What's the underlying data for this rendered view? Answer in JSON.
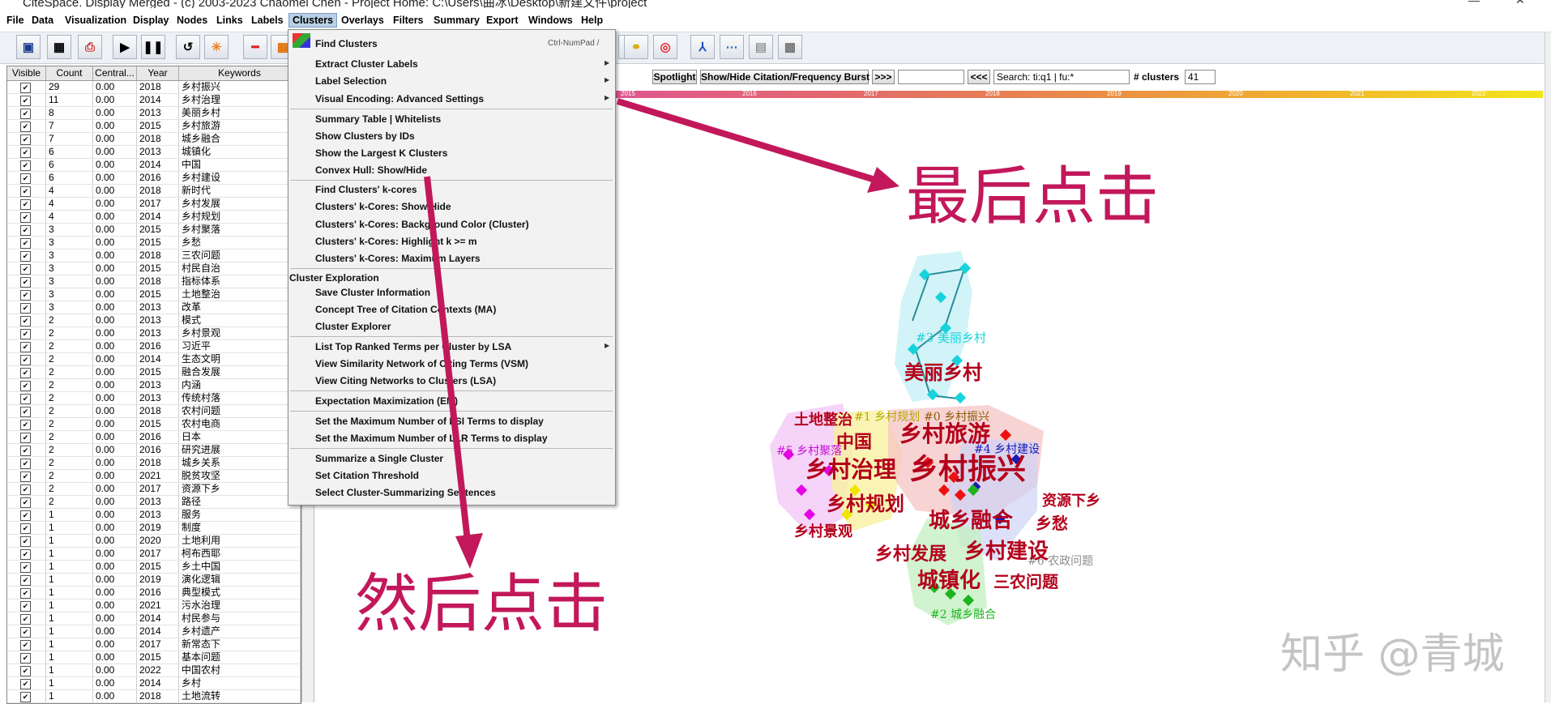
{
  "window": {
    "title": "CiteSpace. Display Merged - (c) 2003-2023 Chaomei Chen - Project Home: C:\\Users\\曲冰\\Desktop\\新建文件\\project"
  },
  "menubar": [
    "File",
    "Data",
    "Visualization",
    "Display",
    "Nodes",
    "Links",
    "Labels",
    "Clusters",
    "Overlays",
    "Filters",
    "Summary",
    "Export",
    "Windows",
    "Help"
  ],
  "menubar_active": "Clusters",
  "table": {
    "headers": [
      "Visible",
      "Count",
      "Central...",
      "Year",
      "Keywords"
    ],
    "rows": [
      [
        "29",
        "0.00",
        "2018",
        "乡村振兴"
      ],
      [
        "11",
        "0.00",
        "2014",
        "乡村治理"
      ],
      [
        "8",
        "0.00",
        "2013",
        "美丽乡村"
      ],
      [
        "7",
        "0.00",
        "2015",
        "乡村旅游"
      ],
      [
        "7",
        "0.00",
        "2018",
        "城乡融合"
      ],
      [
        "6",
        "0.00",
        "2013",
        "城镇化"
      ],
      [
        "6",
        "0.00",
        "2014",
        "中国"
      ],
      [
        "6",
        "0.00",
        "2016",
        "乡村建设"
      ],
      [
        "4",
        "0.00",
        "2018",
        "新时代"
      ],
      [
        "4",
        "0.00",
        "2017",
        "乡村发展"
      ],
      [
        "4",
        "0.00",
        "2014",
        "乡村规划"
      ],
      [
        "3",
        "0.00",
        "2015",
        "乡村聚落"
      ],
      [
        "3",
        "0.00",
        "2015",
        "乡愁"
      ],
      [
        "3",
        "0.00",
        "2018",
        "三农问题"
      ],
      [
        "3",
        "0.00",
        "2015",
        "村民自治"
      ],
      [
        "3",
        "0.00",
        "2018",
        "指标体系"
      ],
      [
        "3",
        "0.00",
        "2015",
        "土地整治"
      ],
      [
        "3",
        "0.00",
        "2013",
        "改革"
      ],
      [
        "2",
        "0.00",
        "2013",
        "模式"
      ],
      [
        "2",
        "0.00",
        "2013",
        "乡村景观"
      ],
      [
        "2",
        "0.00",
        "2016",
        "习近平"
      ],
      [
        "2",
        "0.00",
        "2014",
        "生态文明"
      ],
      [
        "2",
        "0.00",
        "2015",
        "融合发展"
      ],
      [
        "2",
        "0.00",
        "2013",
        "内涵"
      ],
      [
        "2",
        "0.00",
        "2013",
        "传统村落"
      ],
      [
        "2",
        "0.00",
        "2018",
        "农村问题"
      ],
      [
        "2",
        "0.00",
        "2015",
        "农村电商"
      ],
      [
        "2",
        "0.00",
        "2016",
        "日本"
      ],
      [
        "2",
        "0.00",
        "2016",
        "研究进展"
      ],
      [
        "2",
        "0.00",
        "2018",
        "城乡关系"
      ],
      [
        "2",
        "0.00",
        "2021",
        "脱贫攻坚"
      ],
      [
        "2",
        "0.00",
        "2017",
        "资源下乡"
      ],
      [
        "2",
        "0.00",
        "2013",
        "路径"
      ],
      [
        "1",
        "0.00",
        "2013",
        "服务"
      ],
      [
        "1",
        "0.00",
        "2019",
        "制度"
      ],
      [
        "1",
        "0.00",
        "2020",
        "土地利用"
      ],
      [
        "1",
        "0.00",
        "2017",
        "柯布西耶"
      ],
      [
        "1",
        "0.00",
        "2015",
        "乡土中国"
      ],
      [
        "1",
        "0.00",
        "2019",
        "演化逻辑"
      ],
      [
        "1",
        "0.00",
        "2016",
        "典型模式"
      ],
      [
        "1",
        "0.00",
        "2021",
        "污水治理"
      ],
      [
        "1",
        "0.00",
        "2014",
        "村民参与"
      ],
      [
        "1",
        "0.00",
        "2014",
        "乡村遗产"
      ],
      [
        "1",
        "0.00",
        "2017",
        "新常态下"
      ],
      [
        "1",
        "0.00",
        "2015",
        "基本问题"
      ],
      [
        "1",
        "0.00",
        "2022",
        "中国农村"
      ],
      [
        "1",
        "0.00",
        "2014",
        "乡村"
      ],
      [
        "1",
        "0.00",
        "2018",
        "土地流转"
      ]
    ]
  },
  "clusters_menu": {
    "find_clusters": "Find Clusters",
    "find_shortcut": "Ctrl-NumPad /",
    "items_group1": [
      "Extract Cluster Labels",
      "Label Selection",
      "Visual Encoding: Advanced Settings"
    ],
    "items_group2": [
      "Summary Table | Whitelists",
      "Show Clusters by IDs",
      "Show the Largest K Clusters",
      "Convex Hull: Show/Hide"
    ],
    "items_group3": [
      "Find Clusters' k-cores",
      "Clusters' k-Cores: Show/Hide",
      "Clusters' k-Cores: Background Color (Cluster)",
      "Clusters' k-Cores: Highlight k >= m",
      "Clusters' k-Cores: Maximum Layers"
    ],
    "exploration_header": "Cluster Exploration",
    "items_group4": [
      "Save Cluster Information",
      "Concept Tree of Citation Contexts (MA)",
      "Cluster Explorer"
    ],
    "items_group5": [
      "List Top Ranked Terms per Cluster by LSA",
      "View Similarity Network of Citing Terms (VSM)",
      "View Citing Networks to Clusters (LSA)"
    ],
    "items_group6": [
      "Expectation Maximization (EM)"
    ],
    "items_group7": [
      "Set the Maximum Number of LSI Terms to display",
      "Set the Maximum Number of LLR Terms to display"
    ],
    "items_group8": [
      "Summarize a Single Cluster",
      "Set Citation Threshold",
      "Select Cluster-Summarizing Sentences"
    ]
  },
  "controls": {
    "spotlight": "Spotlight",
    "showhide": "Show/Hide Citation/Frequency Burst",
    "next": ">>>",
    "prev": "<<<",
    "search_value": "Search: ti:q1 | fu:*",
    "clusters_label": "# clusters",
    "clusters_value": "41"
  },
  "timeline": {
    "years": [
      "2015",
      "2016",
      "2017",
      "2018",
      "2019",
      "2020",
      "2021",
      "2022"
    ]
  },
  "network": {
    "keyword_labels": [
      "美丽乡村",
      "土地整治",
      "中国",
      "乡村旅游",
      "乡村治理",
      "乡村振兴",
      "乡村规划",
      "资源下乡",
      "乡村景观",
      "城乡融合",
      "乡愁",
      "乡村发展",
      "乡村建设",
      "城镇化",
      "三农问题"
    ],
    "cluster_labels": [
      "#3 美丽乡村",
      "#1 乡村规划",
      "#0 乡村振兴",
      "#5 乡村聚落",
      "#4 乡村建设",
      "#6 农政问题",
      "#2 城乡融合"
    ],
    "colors": {
      "c3": "#19d3dc",
      "c1": "#e3d100",
      "c0": "#8b5a00",
      "c5": "#c60fd8",
      "c4": "#1a1ab8",
      "c6": "#8c8c8c",
      "c2": "#1db41d"
    }
  },
  "annotations": {
    "last_click": "最后点击",
    "then_click": "然后点击"
  },
  "watermark": "知乎 @青城"
}
